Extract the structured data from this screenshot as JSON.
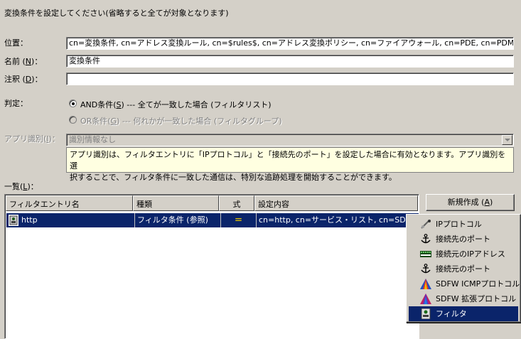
{
  "instruction": "変換条件を設定してください(省略すると全てが対象となります)",
  "position": {
    "label": "位置：",
    "value": "cn=変換条件, cn=アドレス変換ルール, cn=$rules$, cn=アドレス変換ポリシー, cn=ファイアウォール, cn=PDE, cn=PDM, cn=domain"
  },
  "name": {
    "label_prefix": "名前 (",
    "mnemonic": "N",
    "label_suffix": ")：",
    "value": "変換条件"
  },
  "note": {
    "label_prefix": "注釈 (",
    "mnemonic": "D",
    "label_suffix": ")：",
    "value": ""
  },
  "judgment": {
    "label": "判定：",
    "and_option": {
      "prefix": "AND条件(",
      "mnemonic": "S",
      "suffix": ") --- 全てが一致した場合 (フィルタリスト)",
      "selected": true
    },
    "or_option": {
      "prefix": "OR条件(",
      "mnemonic": "G",
      "suffix": ") --- 何れかが一致した場合 (フィルタグループ)",
      "selected": false
    }
  },
  "app_id": {
    "label_prefix": "アプリ識別(",
    "mnemonic": "I",
    "label_suffix": ")：",
    "value": "識別情報なし",
    "description_line1": "アプリ識別は、フィルタエントリに「IPプロトコル」と「接続先のポート」を設定した場合に有効となります。アプリ識別を選",
    "description_line2": "択することで、フィルタ条件に一致した通信は、特別な追跡処理を開始することができます。"
  },
  "list": {
    "label_prefix": "一覧(",
    "mnemonic": "L",
    "label_suffix": ")：",
    "columns": [
      "フィルタエントリ名",
      "種類",
      "式",
      "設定内容"
    ],
    "rows": [
      {
        "name": "http",
        "type": "フィルタ条件 (参照)",
        "expr": "＝",
        "content": "cn=http, cn=サービス・リスト, cn=SDFWリスト"
      }
    ]
  },
  "new_button": {
    "prefix": "新規作成 (",
    "mnemonic": "A",
    "suffix": ")"
  },
  "menu": {
    "items": [
      {
        "label": "IPプロトコル",
        "icon": "ip-protocol-icon"
      },
      {
        "label": "接続先のポート",
        "icon": "anchor-icon"
      },
      {
        "label": "接続元のIPアドレス",
        "icon": "ip-address-icon"
      },
      {
        "label": "接続元のポート",
        "icon": "anchor-icon"
      },
      {
        "label": "SDFW ICMPプロトコル",
        "icon": "icmp-protocol-icon"
      },
      {
        "label": "SDFW 拡張プロトコル",
        "icon": "extended-protocol-icon"
      },
      {
        "label": "フィルタ",
        "icon": "filter-icon",
        "highlighted": true
      }
    ]
  },
  "colors": {
    "selection": "#0a246a",
    "background": "#d4d0c8",
    "tooltip": "#ffffe1"
  }
}
